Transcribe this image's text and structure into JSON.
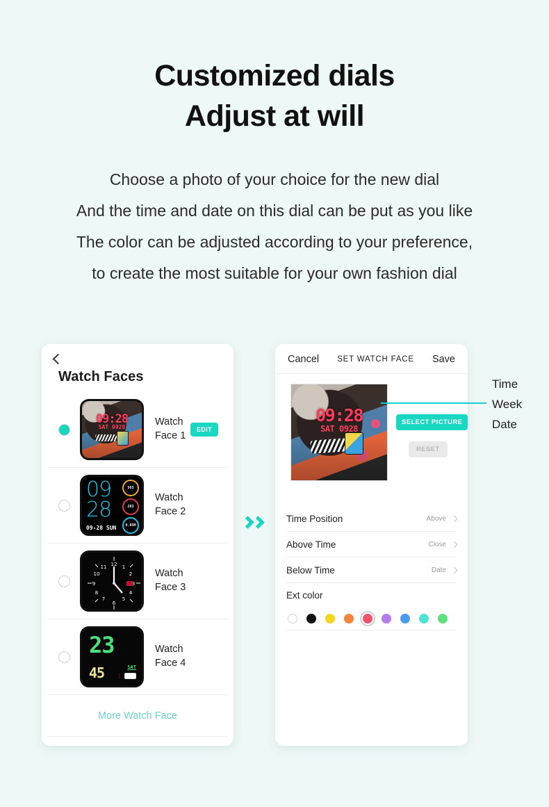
{
  "header": {
    "title_line1": "Customized dials",
    "title_line2": "Adjust at will",
    "sub_line1": "Choose a photo of your choice for the new dial",
    "sub_line2": "And the time and date on this dial can be put as you like",
    "sub_line3": "The color can be adjusted according to your preference,",
    "sub_line4": "to create the most suitable for your own fashion dial"
  },
  "left_panel": {
    "back_icon": "chevron-left-icon",
    "title": "Watch Faces",
    "items": [
      {
        "label_line1": "Watch",
        "label_line2": "Face 1",
        "selected": true,
        "edit_label": "EDIT",
        "preview": {
          "type": "photo",
          "time": "09:28",
          "sub": "SAT 0928"
        }
      },
      {
        "label_line1": "Watch",
        "label_line2": "Face 2",
        "selected": false,
        "edit_label": "",
        "preview": {
          "type": "digital",
          "hour": "09",
          "minute": "28",
          "date": "09-28  SUN",
          "rings": [
            {
              "glyph": "ὒ5",
              "value": "563",
              "color": "#f2a830"
            },
            {
              "glyph": "♥",
              "value": "283",
              "color": "#e63950"
            },
            {
              "glyph": "♪",
              "value": "0.05M",
              "color": "#25c3e8"
            }
          ]
        }
      },
      {
        "label_line1": "Watch",
        "label_line2": "Face 3",
        "selected": false,
        "edit_label": "",
        "preview": {
          "type": "analog",
          "date": "28"
        }
      },
      {
        "label_line1": "Watch",
        "label_line2": "Face 4",
        "selected": false,
        "edit_label": "",
        "preview": {
          "type": "lcd",
          "hour": "23",
          "minute": "45",
          "day": "SAT"
        }
      }
    ],
    "more_link": "More Watch Face"
  },
  "right_panel": {
    "cancel_label": "Cancel",
    "title": "SET WATCH FACE",
    "save_label": "Save",
    "preview": {
      "time": "09:28",
      "sub": "SAT 0928"
    },
    "select_picture_label": "SELECT PICTURE",
    "reset_label": "RESET",
    "settings": [
      {
        "label": "Time Position",
        "value": "Above"
      },
      {
        "label": "Above Time",
        "value": "Close"
      },
      {
        "label": "Below Time",
        "value": "Date"
      }
    ],
    "ext_color_label": "Ext color",
    "swatches": [
      {
        "name": "white",
        "hex": "#ffffff",
        "selected": false
      },
      {
        "name": "black",
        "hex": "#111111",
        "selected": false
      },
      {
        "name": "yellow",
        "hex": "#f5d71e",
        "selected": false
      },
      {
        "name": "orange",
        "hex": "#f4863c",
        "selected": false
      },
      {
        "name": "pink",
        "hex": "#f4526e",
        "selected": true
      },
      {
        "name": "purple",
        "hex": "#b37ce8",
        "selected": false
      },
      {
        "name": "blue",
        "hex": "#4b9bf0",
        "selected": false
      },
      {
        "name": "cyan",
        "hex": "#4fe3d2",
        "selected": false
      },
      {
        "name": "green",
        "hex": "#5fe07e",
        "selected": false
      }
    ]
  },
  "annotations": {
    "arrow_icon": "double-chevron-right-icon",
    "line1": "Time",
    "line2": "Week",
    "line3": "Date"
  }
}
